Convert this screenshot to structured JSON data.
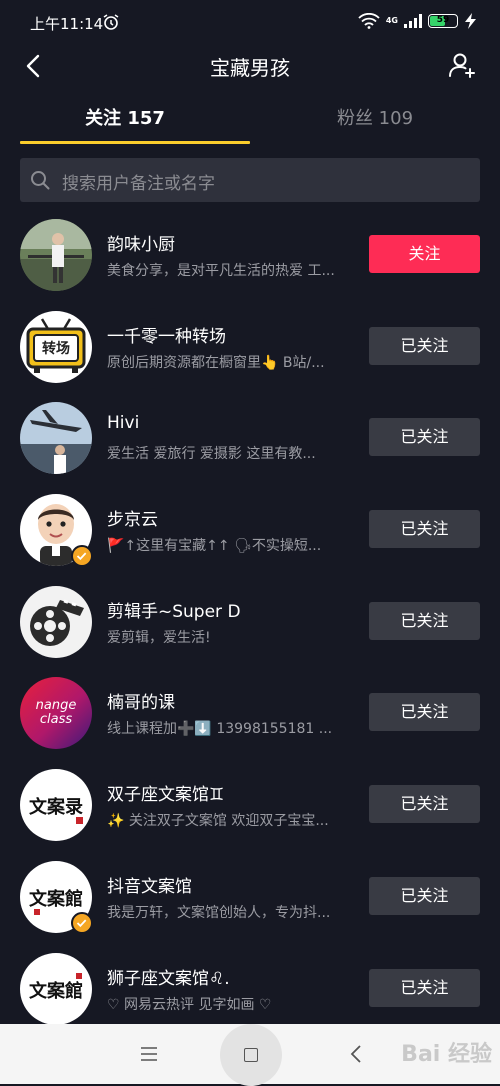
{
  "status_bar": {
    "time": "上午11:14",
    "network": "4G",
    "battery_level": "59",
    "battery_percent": 59
  },
  "header": {
    "title": "宝藏男孩"
  },
  "tabs": {
    "following": "关注 157",
    "fans": "粉丝 109"
  },
  "search": {
    "placeholder": "搜索用户备注或名字"
  },
  "users": [
    {
      "name": "韵味小厨",
      "desc": "美食分享，是对平凡生活的热爱 工...",
      "button": "关注"
    },
    {
      "name": "一千零一种转场",
      "desc": "原创后期资源都在橱窗里👆 B站/...",
      "button": "已关注"
    },
    {
      "name": "Hivi",
      "desc": "爱生活  爱旅行  爱摄影  这里有教...",
      "button": "已关注"
    },
    {
      "name": "步京云",
      "desc": "🚩↑这里有宝藏↑↑ 🗣不实操短...",
      "button": "已关注"
    },
    {
      "name": "剪辑手~Super D",
      "desc": "爱剪辑，爱生活!",
      "button": "已关注"
    },
    {
      "name": "楠哥的课",
      "desc": "线上课程加➕⬇️ 13998155181  ...",
      "button": "已关注"
    },
    {
      "name": "双子座文案馆♊",
      "desc": "✨ 关注双子文案馆 欢迎双子宝宝...",
      "button": "已关注"
    },
    {
      "name": "抖音文案馆",
      "desc": "我是万轩，文案馆创始人，专为抖...",
      "button": "已关注"
    },
    {
      "name": "狮子座文案馆♌.",
      "desc": "♡ 网易云热评 见字如画 ♡",
      "button": "已关注"
    }
  ],
  "avatar_texts": {
    "zhuanchang": "转场",
    "nange_line1": "nange",
    "nange_line2": "class",
    "wenan1": "文案录",
    "wenan2": "文案館",
    "wenan3": "文案館"
  },
  "watermark": "Bai 经验",
  "colors": {
    "background": "#161823",
    "follow_button": "#fe2c55",
    "followed_button": "#393b44",
    "tab_indicator": "#facd2c"
  },
  "icons": [
    "alarm-icon",
    "signal-icon",
    "wifi-icon",
    "battery-icon",
    "charging-icon",
    "back-icon",
    "add-user-icon",
    "search-icon",
    "verified-icon",
    "menu-icon",
    "home-icon",
    "nav-back-icon"
  ]
}
